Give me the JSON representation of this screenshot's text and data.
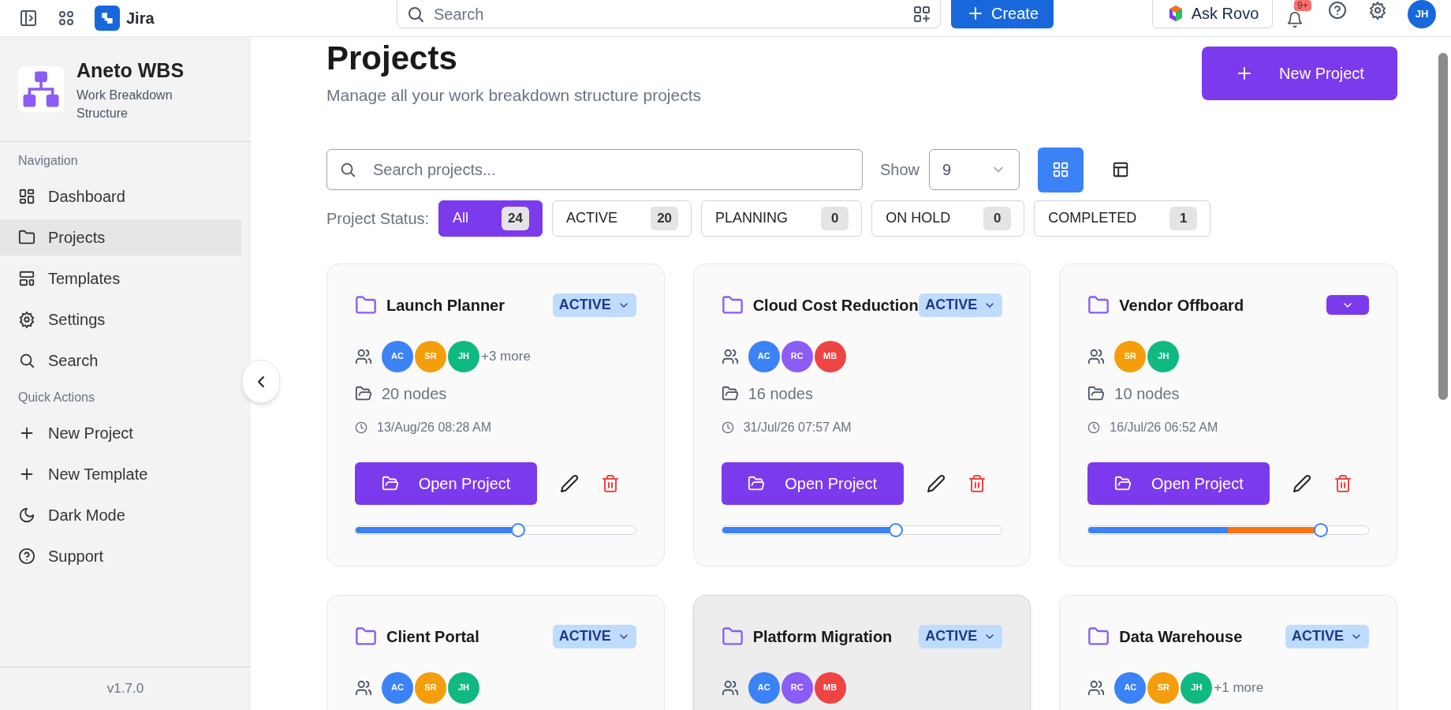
{
  "topbar": {
    "app_name": "Jira",
    "search": {
      "placeholder": "Search"
    },
    "create_label": "Create",
    "rovo_label": "Ask Rovo",
    "notification_badge": "9+",
    "avatar": "JH"
  },
  "sidebar": {
    "brand": {
      "title": "Aneto WBS",
      "subtitle": "Work Breakdown Structure"
    },
    "sections": [
      {
        "heading": "Navigation",
        "items": [
          {
            "label": "Dashboard",
            "selected": false
          },
          {
            "label": "Projects",
            "selected": true
          },
          {
            "label": "Templates",
            "selected": false
          },
          {
            "label": "Settings",
            "selected": false
          },
          {
            "label": "Search",
            "selected": false
          }
        ]
      },
      {
        "heading": "Quick Actions",
        "items": [
          {
            "label": "New Project",
            "selected": false
          },
          {
            "label": "New Template",
            "selected": false
          },
          {
            "label": "Dark Mode",
            "selected": false
          },
          {
            "label": "Support",
            "selected": false
          }
        ]
      }
    ],
    "version": "v1.7.0"
  },
  "page": {
    "title": "Projects",
    "subtitle": "Manage all your work breakdown structure projects",
    "new_project_label": "New Project",
    "search": {
      "placeholder": "Search projects..."
    },
    "show_label": "Show",
    "show_value": "9",
    "views": [
      {
        "kind": "grid",
        "selected": true
      },
      {
        "kind": "table",
        "selected": false
      }
    ],
    "status_label": "Project Status:",
    "filters": [
      {
        "label": "All",
        "count": "24",
        "selected": true
      },
      {
        "label": "ACTIVE",
        "count": "20",
        "selected": false
      },
      {
        "label": "PLANNING",
        "count": "0",
        "selected": false
      },
      {
        "label": "ON HOLD",
        "count": "0",
        "selected": false
      },
      {
        "label": "COMPLETED",
        "count": "1",
        "selected": false
      }
    ]
  },
  "projects": [
    {
      "name": "Launch Planner",
      "status": {
        "kind": "label",
        "text": "ACTIVE"
      },
      "hovered": false,
      "members": [
        {
          "initials": "AC",
          "color": "#3b82f6"
        },
        {
          "initials": "SR",
          "color": "#f59e0b"
        },
        {
          "initials": "JH",
          "color": "#10b981"
        }
      ],
      "more": "+3 more",
      "nodes": "20 nodes",
      "updated": "13/Aug/26 08:28 AM",
      "open_label": "Open Project",
      "progress": {
        "kind": "single",
        "level": 0.58
      }
    },
    {
      "name": "Cloud Cost Reduction",
      "status": {
        "kind": "label",
        "text": "ACTIVE"
      },
      "hovered": false,
      "members": [
        {
          "initials": "AC",
          "color": "#3b82f6"
        },
        {
          "initials": "RC",
          "color": "#8b5cf6"
        },
        {
          "initials": "MB",
          "color": "#ef4444"
        }
      ],
      "nodes": "16 nodes",
      "updated": "31/Jul/26 07:57 AM",
      "open_label": "Open Project",
      "progress": {
        "kind": "single",
        "level": 0.62
      }
    },
    {
      "name": "Vendor Offboard",
      "status": {
        "kind": "blank"
      },
      "hovered": false,
      "members": [
        {
          "initials": "SR",
          "color": "#f59e0b"
        },
        {
          "initials": "JH",
          "color": "#10b981"
        }
      ],
      "nodes": "10 nodes",
      "updated": "16/Jul/26 06:52 AM",
      "open_label": "Open Project",
      "progress": {
        "kind": "two-tone",
        "level": 0.83
      }
    },
    {
      "name": "Client Portal",
      "status": {
        "kind": "label",
        "text": "ACTIVE"
      },
      "hovered": false,
      "members": [
        {
          "initials": "AC",
          "color": "#3b82f6"
        },
        {
          "initials": "SR",
          "color": "#f59e0b"
        },
        {
          "initials": "JH",
          "color": "#10b981"
        }
      ]
    },
    {
      "name": "Platform Migration",
      "status": {
        "kind": "label",
        "text": "ACTIVE"
      },
      "hovered": true,
      "members": [
        {
          "initials": "AC",
          "color": "#3b82f6"
        },
        {
          "initials": "RC",
          "color": "#8b5cf6"
        },
        {
          "initials": "MB",
          "color": "#ef4444"
        }
      ]
    },
    {
      "name": "Data Warehouse",
      "status": {
        "kind": "label",
        "text": "ACTIVE"
      },
      "hovered": false,
      "members": [
        {
          "initials": "AC",
          "color": "#3b82f6"
        },
        {
          "initials": "SR",
          "color": "#f59e0b"
        },
        {
          "initials": "JH",
          "color": "#10b981"
        }
      ],
      "more": "+1 more"
    }
  ]
}
